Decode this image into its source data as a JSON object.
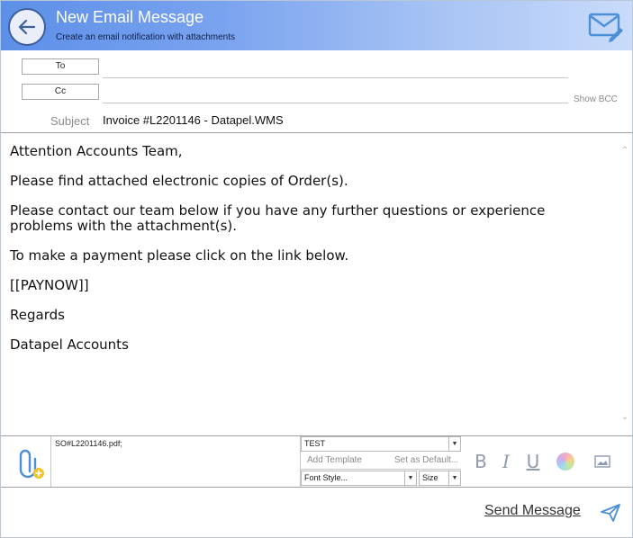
{
  "header": {
    "title": "New Email Message",
    "subtitle": "Create an email notification with attachments"
  },
  "address": {
    "to_label": "To",
    "cc_label": "Cc",
    "to_value": "",
    "cc_value": "",
    "show_bcc": "Show BCC"
  },
  "subject": {
    "label": "Subject",
    "value": "Invoice #L2201146 - Datapel.WMS"
  },
  "body": {
    "paragraphs": [
      "Attention Accounts Team,",
      "Please find attached electronic copies of Order(s).",
      "Please contact our team below if you have any further questions or experience problems with the attachment(s).",
      "To make a payment please click on the link below.",
      "[[PAYNOW]]",
      "Regards",
      "Datapel Accounts"
    ]
  },
  "attachments": {
    "list": "SO#L2201146.pdf;"
  },
  "template": {
    "selected": "TEST",
    "add_template": "Add Template",
    "set_default": "Set as Default...",
    "font_style": "Font Style...",
    "font_size": "Size"
  },
  "format": {
    "bold": "B",
    "italic": "I",
    "underline": "U"
  },
  "footer": {
    "send_label": "Send Message"
  },
  "colors": {
    "header_start": "#5c8fe8",
    "header_end": "#c9dbfa",
    "icon_accent": "#4a8fd8"
  }
}
